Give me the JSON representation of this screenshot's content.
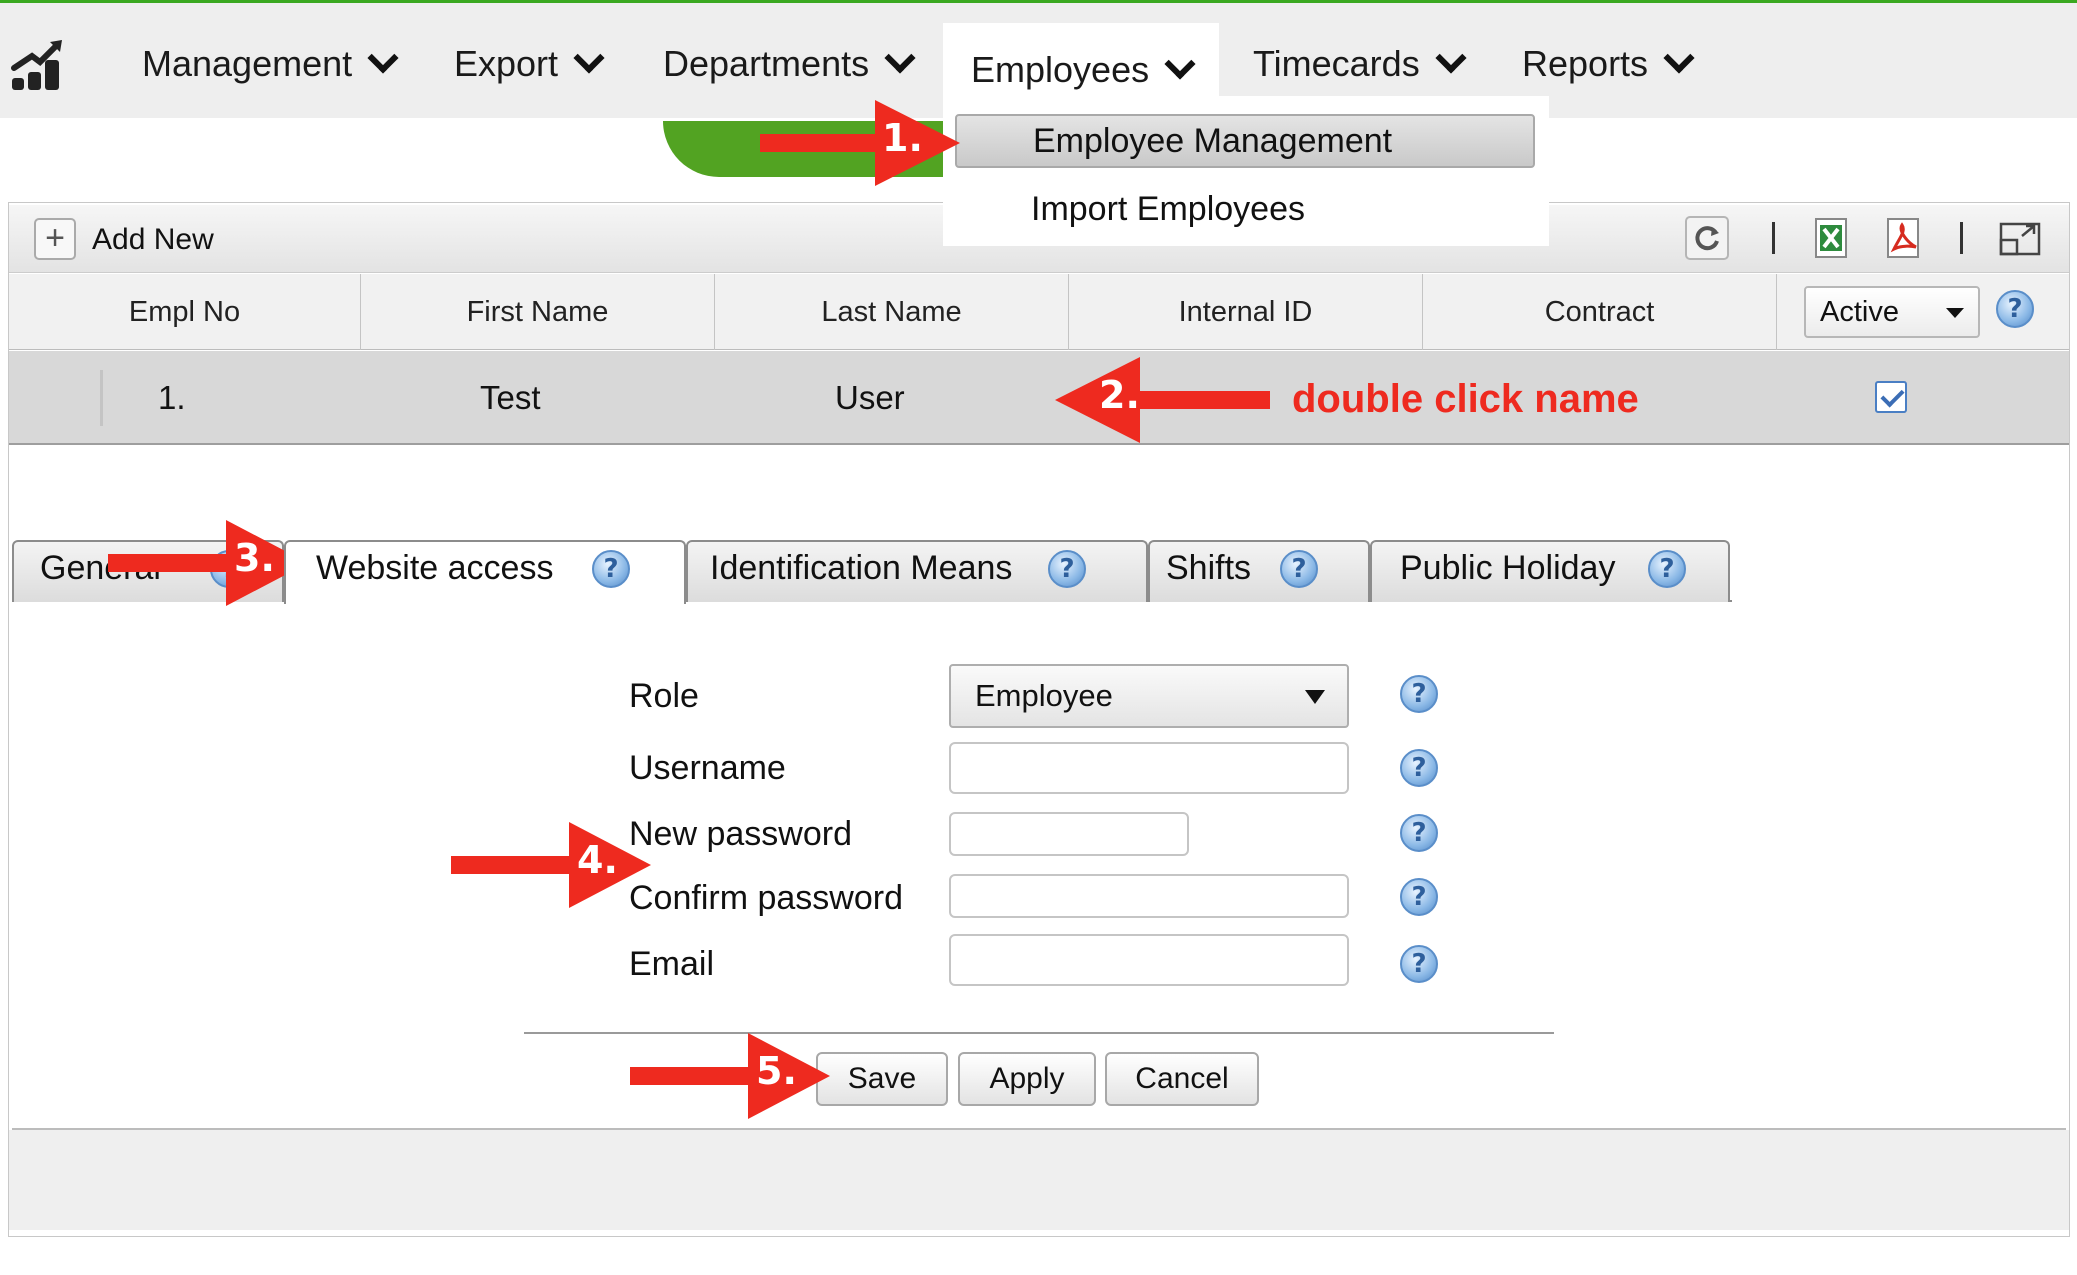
{
  "nav": {
    "items": [
      {
        "label": "Management"
      },
      {
        "label": "Export"
      },
      {
        "label": "Departments"
      },
      {
        "label": "Employees"
      },
      {
        "label": "Timecards"
      },
      {
        "label": "Reports"
      }
    ]
  },
  "dropdown": {
    "items": [
      {
        "label": "Employee Management"
      },
      {
        "label": "Import Employees"
      }
    ]
  },
  "toolbar": {
    "add_label": "Add New"
  },
  "table": {
    "columns": [
      "Empl No",
      "First Name",
      "Last Name",
      "Internal ID",
      "Contract"
    ],
    "filter_value": "Active",
    "rows": [
      {
        "empl_no": "1.",
        "first_name": "Test",
        "last_name": "User",
        "internal_id": "",
        "contract": "",
        "active": true
      }
    ]
  },
  "tabs": [
    {
      "label": "General"
    },
    {
      "label": "Website access"
    },
    {
      "label": "Identification Means"
    },
    {
      "label": "Shifts"
    },
    {
      "label": "Public Holiday"
    }
  ],
  "form": {
    "role_label": "Role",
    "role_value": "Employee",
    "username_label": "Username",
    "username_value": "",
    "new_password_label": "New password",
    "new_password_value": "",
    "confirm_password_label": "Confirm password",
    "confirm_password_value": "",
    "email_label": "Email",
    "email_value": ""
  },
  "buttons": {
    "save": "Save",
    "apply": "Apply",
    "cancel": "Cancel"
  },
  "annotations": {
    "step1": "1.",
    "step2": "2.",
    "step2_text": "double click name",
    "step3": "3.",
    "step4": "4.",
    "step5": "5."
  },
  "icons": {
    "help": "?",
    "add": "+"
  },
  "colors": {
    "accent_green": "#3aa820",
    "annotation_red": "#ee2a1f",
    "help_blue": "#4f86c6"
  }
}
